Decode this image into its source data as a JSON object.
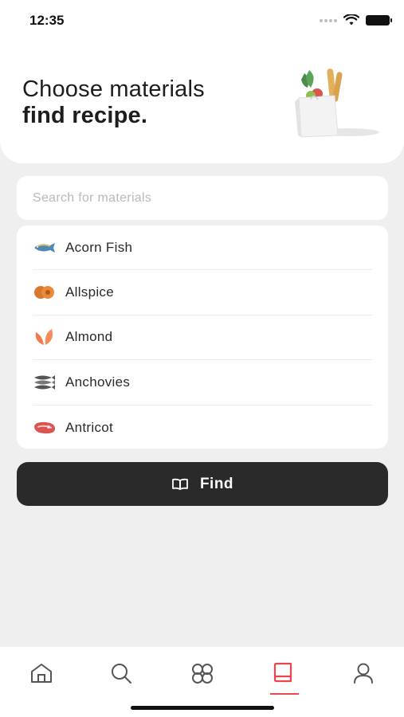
{
  "status_bar": {
    "time": "12:35"
  },
  "header": {
    "title_line1": "Choose materials",
    "title_line2": "find recipe."
  },
  "search": {
    "placeholder": "Search for materials",
    "value": ""
  },
  "materials": [
    {
      "label": "Acorn Fish",
      "icon": "fish-icon"
    },
    {
      "label": "Allspice",
      "icon": "allspice-icon"
    },
    {
      "label": "Almond",
      "icon": "almond-icon"
    },
    {
      "label": "Anchovies",
      "icon": "anchovies-icon"
    },
    {
      "label": "Antricot",
      "icon": "steak-icon"
    }
  ],
  "find_button": {
    "label": "Find",
    "icon": "book-open-icon"
  },
  "tabbar": {
    "tabs": [
      {
        "icon": "home-icon",
        "active": false
      },
      {
        "icon": "search-icon",
        "active": false
      },
      {
        "icon": "community-icon",
        "active": false
      },
      {
        "icon": "book-icon",
        "active": true
      },
      {
        "icon": "profile-icon",
        "active": false
      }
    ],
    "active_color": "#e8474f"
  },
  "colors": {
    "accent": "#e8474f",
    "button_bg": "#2a2a2a",
    "page_bg": "#efefef"
  }
}
